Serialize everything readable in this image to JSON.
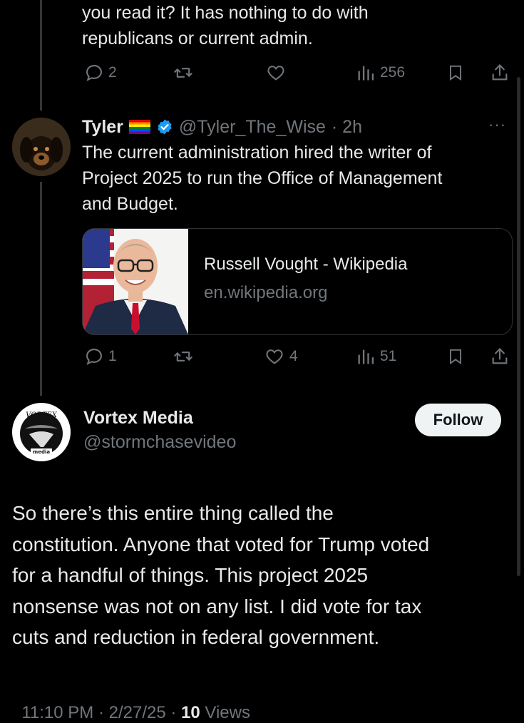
{
  "prev_tweet": {
    "text_line1": "you read it?  It has nothing to do with",
    "text_line2": "republicans or current admin.",
    "actions": {
      "replies": "2",
      "views": "256"
    }
  },
  "reply": {
    "name": "Tyler",
    "handle": "@Tyler_The_Wise",
    "time": "· 2h",
    "more": "···",
    "text_line1": "The current administration hired the writer of",
    "text_line2": "Project 2025 to run the Office of Management",
    "text_line3": "and Budget.",
    "card": {
      "title": "Russell Vought - Wikipedia",
      "domain": "en.wikipedia.org"
    },
    "actions": {
      "replies": "1",
      "likes": "4",
      "views": "51"
    }
  },
  "main": {
    "name": "Vortex Media",
    "handle": "@stormchasevideo",
    "follow_label": "Follow",
    "avatar_text_top": "VORTEX",
    "avatar_text_bottom": "media",
    "text_lines": [
      "So there’s this entire thing called the",
      "constitution. Anyone that voted for Trump voted",
      "for a handful of things. This project 2025",
      "nonsense was not on any list. I did vote for tax",
      "cuts and reduction in federal government."
    ],
    "meta": {
      "timestamp": "11:10 PM · 2/27/25 · ",
      "views_count": "10",
      "views_label": " Views"
    }
  },
  "colors": {
    "background": "#000000",
    "text": "#e7e9ea",
    "muted": "#71767b",
    "verified": "#1d9bf0",
    "border": "#2f3336"
  }
}
